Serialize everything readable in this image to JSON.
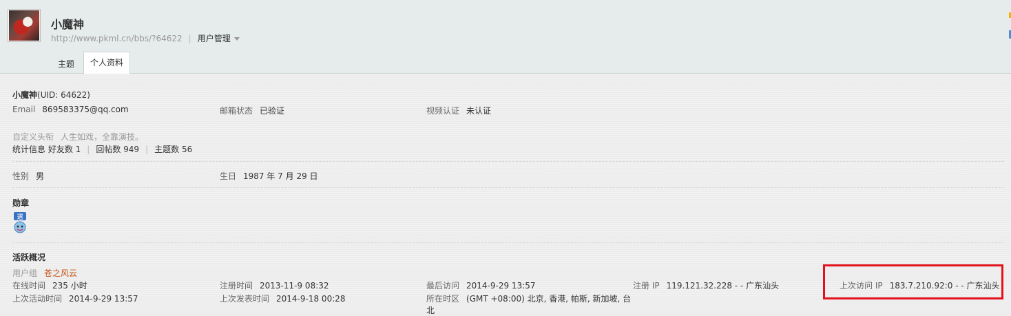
{
  "header": {
    "username": "小魔神",
    "profile_url": "http://www.pkml.cn/bbs/?64622",
    "user_menu_label": "用户管理",
    "tabs": [
      {
        "label": "主题"
      },
      {
        "label": "个人资料"
      }
    ]
  },
  "profile": {
    "name": "小魔神",
    "uid_text": "(UID: 64622)",
    "email_label": "Email",
    "email_value": "869583375@qq.com",
    "mail_status_label": "邮箱状态",
    "mail_status_value": "已验证",
    "video_label": "视频认证",
    "video_value": "未认证",
    "custom_title_label": "自定义头衔",
    "custom_title_value": "人生如戏，全靠演技。",
    "stats_label": "统计信息",
    "friends": "好友数 1",
    "replies": "回帖数 949",
    "topics": "主题数 56",
    "gender_label": "性别",
    "gender_value": "男",
    "birthday_label": "生日",
    "birthday_value": "1987 年 7 月 29 日"
  },
  "medals": {
    "title": "勋章",
    "icon": "medal-icon"
  },
  "activity": {
    "title": "活跃概况",
    "group_label": "用户组",
    "group_value": "苍之风云",
    "online_label": "在线时间",
    "online_value": "235 小时",
    "reg_time_label": "注册时间",
    "reg_time_value": "2013-11-9 08:32",
    "last_visit_label": "最后访问",
    "last_visit_value": "2014-9-29 13:57",
    "reg_ip_label": "注册 IP",
    "reg_ip_value": "119.121.32.228 - - 广东汕头",
    "last_ip_label": "上次访问 IP",
    "last_ip_value": "183.7.210.92:0 - - 广东汕头",
    "last_active_label": "上次活动时间",
    "last_active_value": "2014-9-29 13:57",
    "last_post_label": "上次发表时间",
    "last_post_value": "2014-9-18 00:28",
    "timezone_label": "所在时区",
    "timezone_value_line1": "(GMT +08:00) 北京, 香港, 帕斯, 新加坡, 台",
    "timezone_value_line2": "北"
  },
  "colors": {
    "header_bg": "#e6eceb",
    "highlight_border": "#e3111b",
    "group_color": "#c45517"
  }
}
